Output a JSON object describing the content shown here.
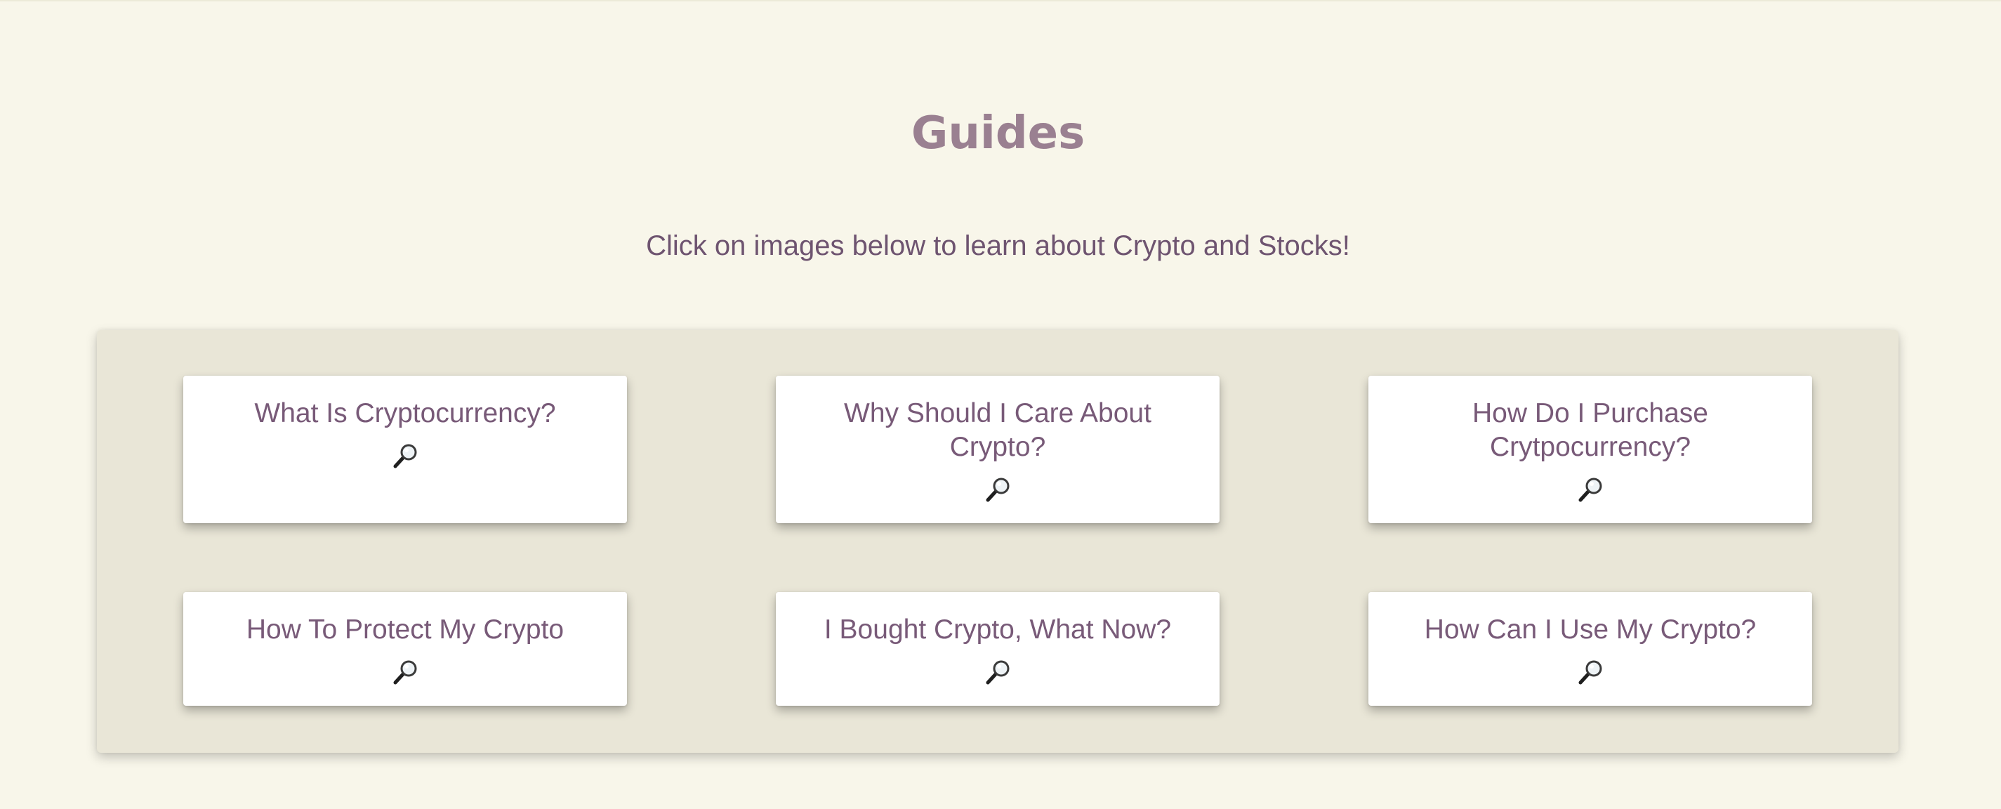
{
  "header": {
    "title": "Guides",
    "subtitle": "Click on images below to learn about Crypto and Stocks!"
  },
  "guides": [
    {
      "title": "What Is Cryptocurrency?",
      "icon": "magnifying-glass-icon"
    },
    {
      "title": "Why Should I Care About Crypto?",
      "icon": "magnifying-glass-icon"
    },
    {
      "title": "How Do I Purchase Crytpocurrency?",
      "icon": "magnifying-glass-icon"
    },
    {
      "title": "How To Protect My Crypto",
      "icon": "magnifying-glass-icon"
    },
    {
      "title": "I Bought Crypto, What Now?",
      "icon": "magnifying-glass-icon"
    },
    {
      "title": "How Can I Use My Crypto?",
      "icon": "magnifying-glass-icon"
    }
  ],
  "colors": {
    "background": "#f8f6ea",
    "panel": "#e9e6d7",
    "card": "#ffffff",
    "title": "#9a8091",
    "text": "#6e5470"
  }
}
